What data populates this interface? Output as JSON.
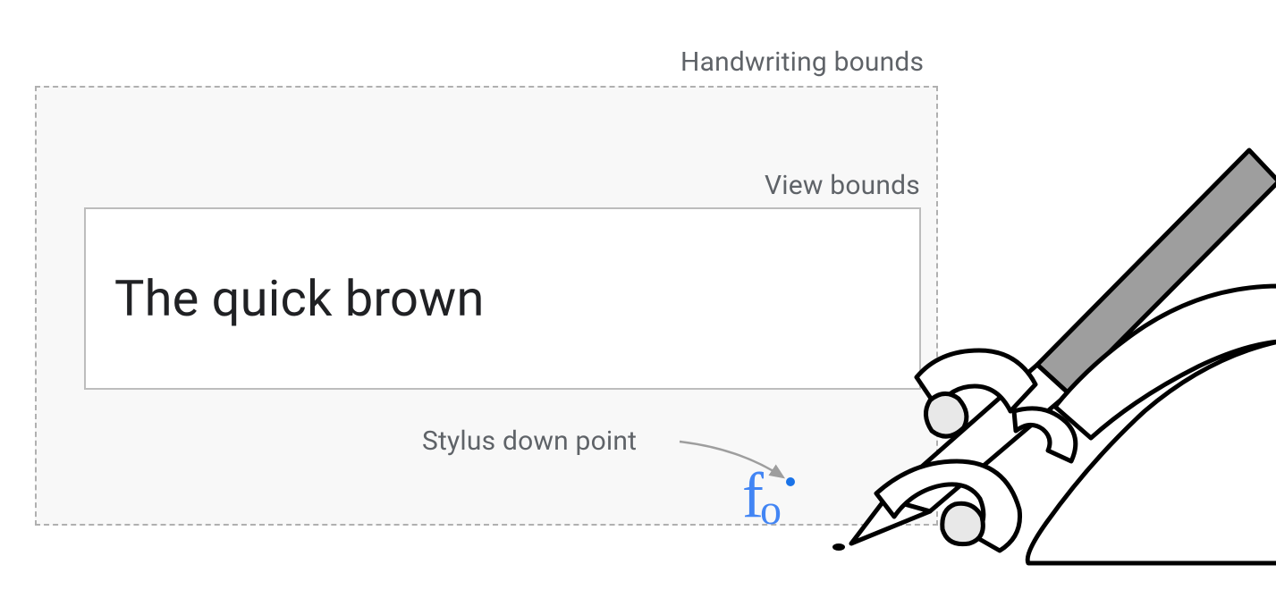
{
  "labels": {
    "handwriting_bounds": "Handwriting bounds",
    "view_bounds": "View bounds",
    "stylus_down_point": "Stylus down point"
  },
  "text_field": {
    "value": "The quick brown"
  },
  "handwriting": {
    "first_char": "f",
    "second_char": "o"
  },
  "colors": {
    "label": "#5f6368",
    "text": "#202124",
    "ink": "#4285F4",
    "dashed_border": "#b0b0b0",
    "view_border": "#bdbdbd",
    "handwriting_bg": "#f8f8f8",
    "stylus_fill": "#9e9e9e",
    "line": "#000000"
  }
}
